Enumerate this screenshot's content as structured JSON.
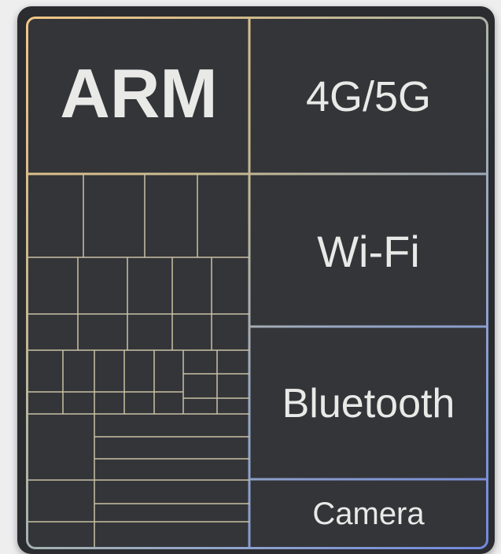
{
  "blocks": {
    "arm": "ARM",
    "cellular": "4G/5G",
    "wifi": "Wi-Fi",
    "bluetooth": "Bluetooth",
    "camera": "Camera"
  },
  "colors": {
    "border_gradient": [
      "#f2c786",
      "#cbb88c",
      "#a9b4ab",
      "#8fa3cc",
      "#7288de"
    ],
    "die_fill": "#343539",
    "text": "#e9e9e7"
  }
}
